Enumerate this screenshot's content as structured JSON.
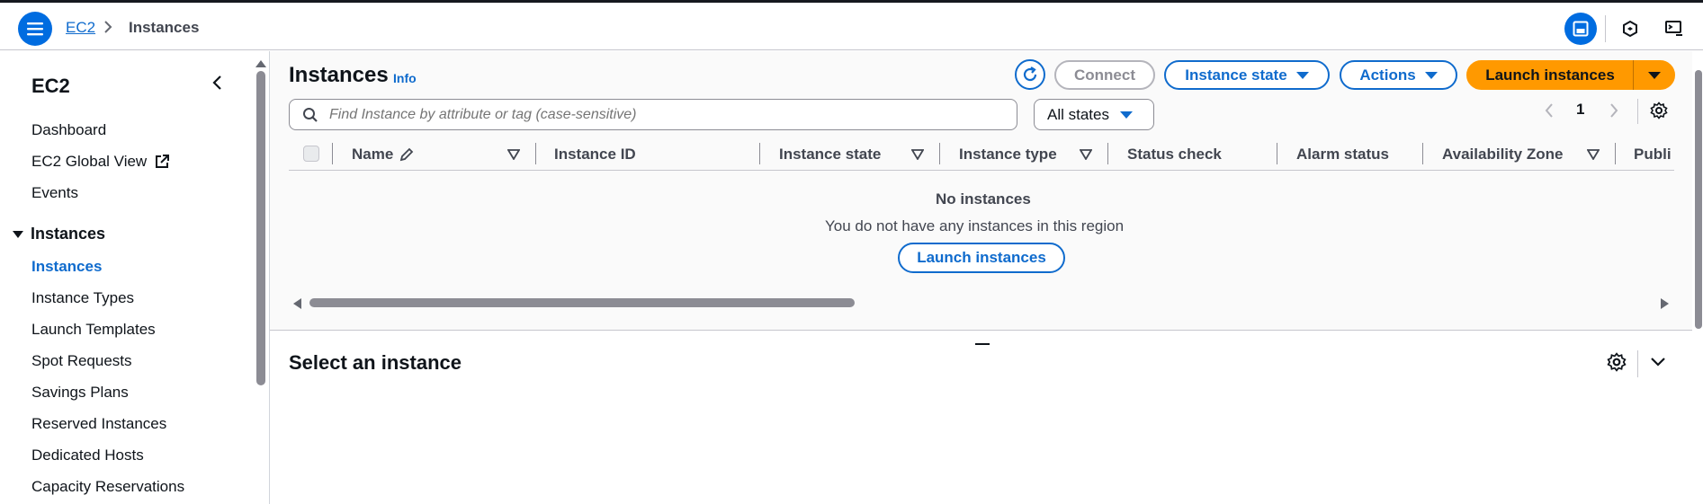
{
  "topbar": {
    "breadcrumb_service": "EC2",
    "breadcrumb_current": "Instances"
  },
  "sidebar": {
    "title": "EC2",
    "items": [
      {
        "label": "Dashboard"
      },
      {
        "label": "EC2 Global View"
      },
      {
        "label": "Events"
      }
    ],
    "section": {
      "label": "Instances",
      "expanded": true
    },
    "section_items": [
      {
        "label": "Instances",
        "active": true
      },
      {
        "label": "Instance Types"
      },
      {
        "label": "Launch Templates"
      },
      {
        "label": "Spot Requests"
      },
      {
        "label": "Savings Plans"
      },
      {
        "label": "Reserved Instances"
      },
      {
        "label": "Dedicated Hosts"
      },
      {
        "label": "Capacity Reservations"
      }
    ]
  },
  "main": {
    "title": "Instances",
    "info_label": "Info",
    "buttons": {
      "connect": "Connect",
      "instance_state": "Instance state",
      "actions": "Actions",
      "launch": "Launch instances"
    },
    "search": {
      "placeholder": "Find Instance by attribute or tag (case-sensitive)"
    },
    "state_filter": {
      "selected": "All states"
    },
    "pagination": {
      "page": "1"
    },
    "columns": [
      "Name",
      "Instance ID",
      "Instance state",
      "Instance type",
      "Status check",
      "Alarm status",
      "Availability Zone",
      "Publi"
    ],
    "empty": {
      "title": "No instances",
      "subtitle": "You do not have any instances in this region",
      "button": "Launch instances"
    }
  },
  "detail": {
    "title": "Select an instance"
  },
  "colors": {
    "accent": "#0f6bcd",
    "primary_button": "#ff9900",
    "menu_button": "#006ce0"
  }
}
